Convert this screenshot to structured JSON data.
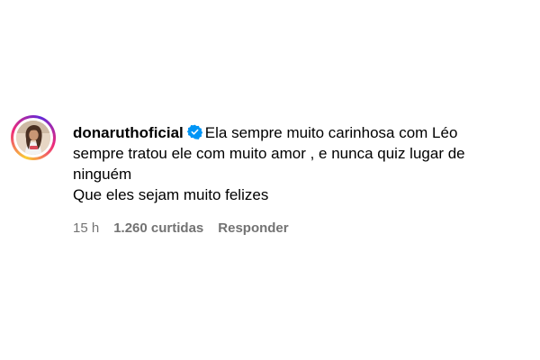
{
  "comment": {
    "username": "donaruthoficial",
    "verified_icon": "verified-badge-icon",
    "text_line_1": "Ela sempre muito carinhosa com Léo",
    "text_line_2": "sempre tratou ele com muito amor , e nunca quiz lugar de",
    "text_line_3": "ninguém",
    "text_line_4": "Que eles sejam muito felizes",
    "time": "15 h",
    "likes": "1.260 curtidas",
    "reply_label": "Responder"
  },
  "colors": {
    "verified": "#0095f6",
    "meta_text": "#737373"
  }
}
